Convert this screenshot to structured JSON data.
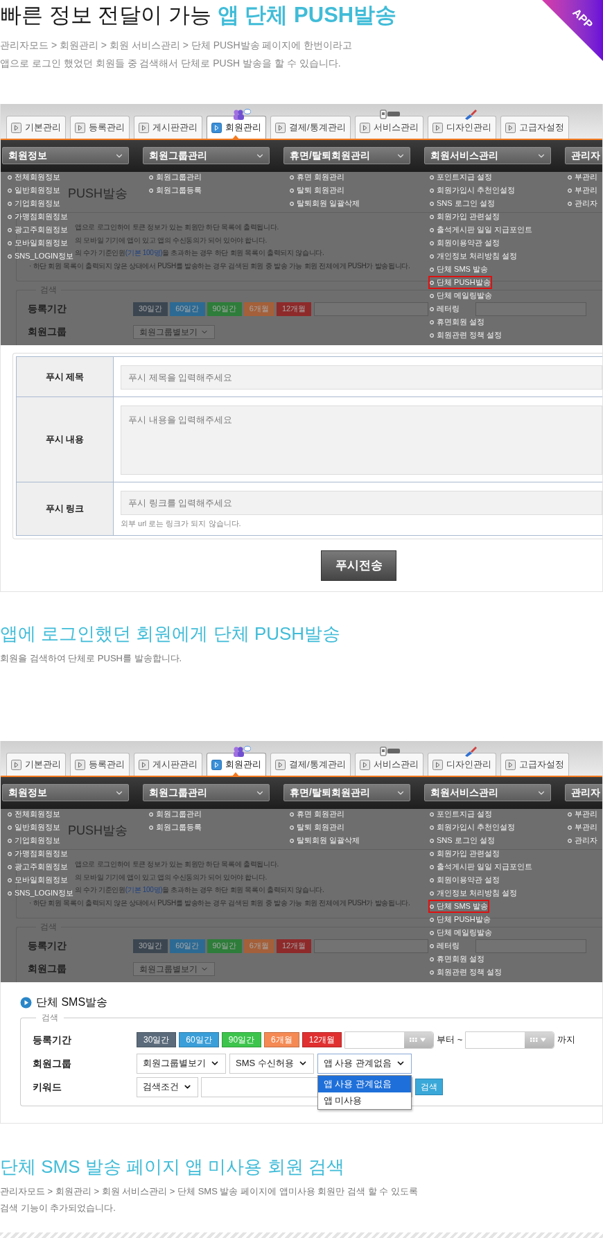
{
  "corner_badge": "APP",
  "intro": {
    "title": "빠른 정보 전달이 가능",
    "title_highlight": "앱 단체 PUSH발송",
    "lines": [
      "관리자모드 >  회원관리 > 회원 서비스관리 > 단체 PUSH발송 페이지에 한번이라고",
      "앱으로 로그인 했었던 회원들 중 검색해서 단체로 PUSH 발송을 할 수 있습니다."
    ]
  },
  "screenshot_1": {
    "admin": {
      "tabs": [
        {
          "label": "기본관리",
          "selected": false
        },
        {
          "label": "등록관리",
          "selected": false
        },
        {
          "label": "게시판관리",
          "selected": false
        },
        {
          "label": "회원관리",
          "selected": true,
          "badge": {
            "kind": "people"
          }
        },
        {
          "label": "결제/통계관리",
          "selected": false
        },
        {
          "label": "서비스관리",
          "selected": false,
          "badge": {
            "kind": "tag"
          }
        },
        {
          "label": "디자인관리",
          "selected": false,
          "badge": {
            "kind": "brush"
          }
        },
        {
          "label": "고급자설정",
          "selected": false
        }
      ],
      "menu_headers": [
        "회원정보",
        "회원그룹관리",
        "휴면/탈퇴회원관리",
        "회원서비스관리",
        "관리자"
      ],
      "menu_columns": [
        [
          {
            "label": "전체회원정보",
            "selected": false
          },
          {
            "label": "일반회원정보",
            "selected": false
          },
          {
            "label": "기업회원정보",
            "selected": false
          },
          {
            "label": "가맹점회원정보",
            "selected": false
          },
          {
            "label": "광고주회원정보",
            "selected": false
          },
          {
            "label": "모바일회원정보",
            "selected": false
          },
          {
            "label": "SNS_LOGIN정보",
            "selected": false
          }
        ],
        [
          {
            "label": "회원그룹관리",
            "selected": false
          },
          {
            "label": "회원그룹등록",
            "selected": false
          }
        ],
        [
          {
            "label": "휴면 회원관리",
            "selected": false
          },
          {
            "label": "탈퇴 회원관리",
            "selected": false
          },
          {
            "label": "탈퇴회원 일괄삭제",
            "selected": false
          }
        ],
        [
          {
            "label": "포인트지급 설정",
            "selected": false
          },
          {
            "label": "회원가입시 추천인설정",
            "selected": false
          },
          {
            "label": "SNS 로그인 설정",
            "selected": false
          },
          {
            "label": "회원가입 관련설정",
            "selected": false
          },
          {
            "label": "출석게시판 일일 지급포인트",
            "selected": false
          },
          {
            "label": "회원이용약관 설정",
            "selected": false
          },
          {
            "label": "개인정보 처리방침 설정",
            "selected": false
          },
          {
            "label": "단체 SMS 발송",
            "selected": false
          },
          {
            "label": "단체 PUSH발송",
            "selected": true
          },
          {
            "label": "단체 메일링발송",
            "selected": false
          },
          {
            "label": "레터링",
            "selected": false
          },
          {
            "label": "휴면회원 설정",
            "selected": false
          },
          {
            "label": "회원관련 정책 설정",
            "selected": false
          }
        ],
        [
          {
            "label": "부관리",
            "selected": false
          },
          {
            "label": "부관리",
            "selected": false
          },
          {
            "label": "관리자",
            "selected": false
          }
        ]
      ],
      "underlay": {
        "title": "PUSH발송",
        "notes": [
          {
            "kind": "partial",
            "text": "앱으로 로그인하여 토큰 정보가 있는 회원만 하단 목록에 출력됩니다."
          },
          {
            "kind": "partial",
            "text": "의 모바일 기기에 앱이 있고 앱의 수신동의가 되어 있어야 합니다."
          },
          {
            "kind": "partial",
            "text": "의 수가 기준인원",
            "highlight": "(기본 100명)",
            "rest": "을 초과하는 경우 하단 회원 목록이 출력되지 않습니다."
          },
          {
            "kind": "full",
            "text": "· 하단 회원 목록이 출력되지 않은 상태에서 PUSH를 발송하는 경우 검색된 회원 중 발송 가능 회원 전체에게 PUSH가 발송됩니다."
          }
        ],
        "legend": "검색",
        "period_label": "등록기간",
        "group_label": "회원그룹",
        "group_select": "회원그룹별보기",
        "periods": [
          {
            "label": "30일간",
            "color": "#3b4651"
          },
          {
            "label": "60일간",
            "color": "#2d6a93"
          },
          {
            "label": "90일간",
            "color": "#2e7d3a"
          },
          {
            "label": "6개월",
            "color": "#a4603a"
          },
          {
            "label": "12개월",
            "color": "#8e2a2a"
          }
        ]
      }
    },
    "push_form": {
      "rows": [
        {
          "kind": "input",
          "label": "푸시 제목",
          "placeholder": "푸시 제목을 입력해주세요"
        },
        {
          "kind": "textarea",
          "label": "푸시 내용",
          "placeholder": "푸시 내용을 입력해주세요"
        },
        {
          "kind": "input",
          "label": "푸시 링크",
          "placeholder": "푸시 링크를 입력해주세요",
          "help": "외부 url 로는 링크가 되지 않습니다."
        }
      ],
      "submit": "푸시전송"
    }
  },
  "section_2": {
    "title": "앱에 로그인했던 회원에게 단체 PUSH발송",
    "lines": [
      "회원을 검색하여 단체로 PUSH를 발송합니다."
    ]
  },
  "screenshot_2": {
    "admin": {
      "tabs": [
        {
          "label": "기본관리",
          "selected": false
        },
        {
          "label": "등록관리",
          "selected": false
        },
        {
          "label": "게시판관리",
          "selected": false
        },
        {
          "label": "회원관리",
          "selected": true,
          "badge": {
            "kind": "people"
          }
        },
        {
          "label": "결제/통계관리",
          "selected": false
        },
        {
          "label": "서비스관리",
          "selected": false,
          "badge": {
            "kind": "tag"
          }
        },
        {
          "label": "디자인관리",
          "selected": false,
          "badge": {
            "kind": "brush"
          }
        },
        {
          "label": "고급자설정",
          "selected": false
        }
      ],
      "menu_headers": [
        "회원정보",
        "회원그룹관리",
        "휴면/탈퇴회원관리",
        "회원서비스관리",
        "관리자"
      ],
      "menu_columns": [
        [
          {
            "label": "전체회원정보",
            "selected": false
          },
          {
            "label": "일반회원정보",
            "selected": false
          },
          {
            "label": "기업회원정보",
            "selected": false
          },
          {
            "label": "가맹점회원정보",
            "selected": false
          },
          {
            "label": "광고주회원정보",
            "selected": false
          },
          {
            "label": "모바일회원정보",
            "selected": false
          },
          {
            "label": "SNS_LOGIN정보",
            "selected": false
          }
        ],
        [
          {
            "label": "회원그룹관리",
            "selected": false
          },
          {
            "label": "회원그룹등록",
            "selected": false
          }
        ],
        [
          {
            "label": "휴면 회원관리",
            "selected": false
          },
          {
            "label": "탈퇴 회원관리",
            "selected": false
          },
          {
            "label": "탈퇴회원 일괄삭제",
            "selected": false
          }
        ],
        [
          {
            "label": "포인트지급 설정",
            "selected": false
          },
          {
            "label": "회원가입시 추천인설정",
            "selected": false
          },
          {
            "label": "SNS 로그인 설정",
            "selected": false
          },
          {
            "label": "회원가입 관련설정",
            "selected": false
          },
          {
            "label": "출석게시판 일일 지급포인트",
            "selected": false
          },
          {
            "label": "회원이용약관 설정",
            "selected": false
          },
          {
            "label": "개인정보 처리방침 설정",
            "selected": false
          },
          {
            "label": "단체 SMS 발송",
            "selected": true
          },
          {
            "label": "단체 PUSH발송",
            "selected": false
          },
          {
            "label": "단체 메일링발송",
            "selected": false
          },
          {
            "label": "레터링",
            "selected": false
          },
          {
            "label": "휴면회원 설정",
            "selected": false
          },
          {
            "label": "회원관련 정책 설정",
            "selected": false
          }
        ],
        [
          {
            "label": "부관리",
            "selected": false
          },
          {
            "label": "부관리",
            "selected": false
          },
          {
            "label": "관리자",
            "selected": false
          }
        ]
      ],
      "underlay": {
        "title": "PUSH발송",
        "notes": [
          {
            "kind": "partial",
            "text": "앱으로 로그인하여 토큰 정보가 있는 회원만 하단 목록에 출력됩니다."
          },
          {
            "kind": "partial",
            "text": "의 모바일 기기에 앱이 있고 앱의 수신동의가 되어 있어야 합니다."
          },
          {
            "kind": "partial",
            "text": "의 수가 기준인원",
            "highlight": "(기본 100명)",
            "rest": "을 초과하는 경우 하단 회원 목록이 출력되지 않습니다."
          },
          {
            "kind": "full",
            "text": "· 하단 회원 목록이 출력되지 않은 상태에서 PUSH를 발송하는 경우 검색된 회원 중 발송 가능 회원 전체에게 PUSH가 발송됩니다."
          }
        ],
        "legend": "검색",
        "period_label": "등록기간",
        "group_label": "회원그룹",
        "group_select": "회원그룹별보기",
        "periods": [
          {
            "label": "30일간",
            "color": "#3b4651"
          },
          {
            "label": "60일간",
            "color": "#2d6a93"
          },
          {
            "label": "90일간",
            "color": "#2e7d3a"
          },
          {
            "label": "6개월",
            "color": "#a4603a"
          },
          {
            "label": "12개월",
            "color": "#8e2a2a"
          }
        ]
      }
    },
    "sms_form": {
      "title": "단체 SMS발송",
      "legend": "검색",
      "period_label": "등록기간",
      "periods": [
        {
          "label": "30일간",
          "color": "#5b6b7b"
        },
        {
          "label": "60일간",
          "color": "#3a9ed8"
        },
        {
          "label": "90일간",
          "color": "#3cc44c"
        },
        {
          "label": "6개월",
          "color": "#f58a54"
        },
        {
          "label": "12개월",
          "color": "#e03030"
        }
      ],
      "from_label": "부터 ~",
      "to_label": "까지",
      "group_label": "회원그룹",
      "selects": [
        {
          "value": "회원그룹별보기",
          "expanded": false
        },
        {
          "value": "SMS 수신허용",
          "expanded": false
        },
        {
          "value": "앱 사용 관계없음",
          "expanded": true,
          "options": [
            {
              "label": "앱 사용 관계없음",
              "selected": true
            },
            {
              "label": "앱 미사용",
              "selected": false
            }
          ]
        }
      ],
      "keyword_label": "키워드",
      "condition_select": "검색조건",
      "search_button": "검색"
    }
  },
  "section_3": {
    "title": "단체 SMS 발송 페이지 앱 미사용 회원 검색",
    "lines": [
      "관리자모드 > 회원관리 > 회원 서비스관리 > 단체 SMS 발송 페이지에 앱미사용 회원만 검색 할 수 있도록",
      "검색 기능이 추가되었습니다."
    ]
  }
}
